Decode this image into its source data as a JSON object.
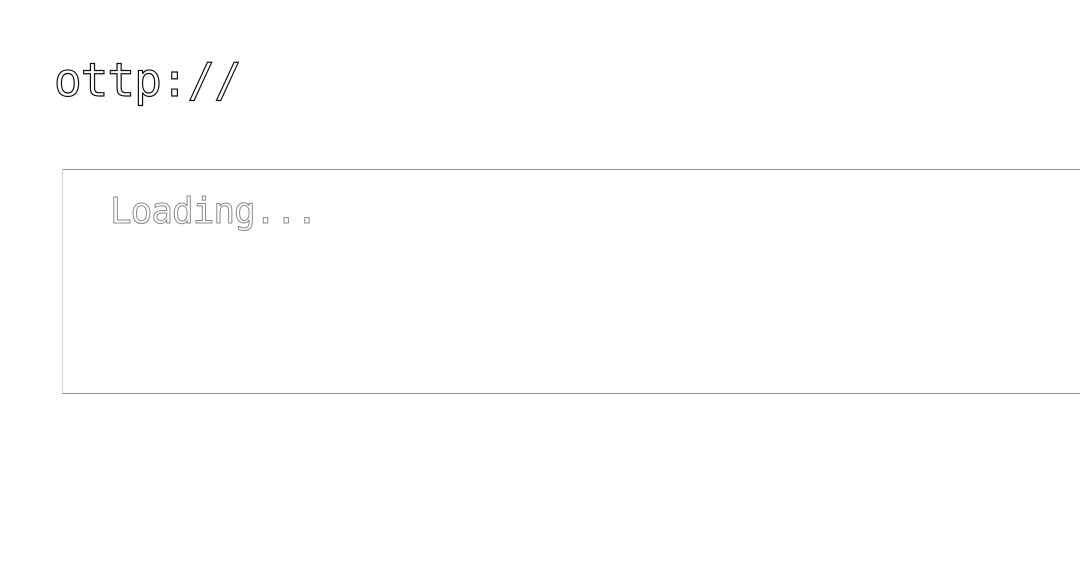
{
  "header": {
    "logo_text": "ottp://"
  },
  "panel": {
    "status_text": "Loading..."
  },
  "colors": {
    "background": "#ffffff",
    "logo_outline": "#111111",
    "status_outline": "#8a8a8a",
    "panel_border": "#8e8e8e"
  }
}
